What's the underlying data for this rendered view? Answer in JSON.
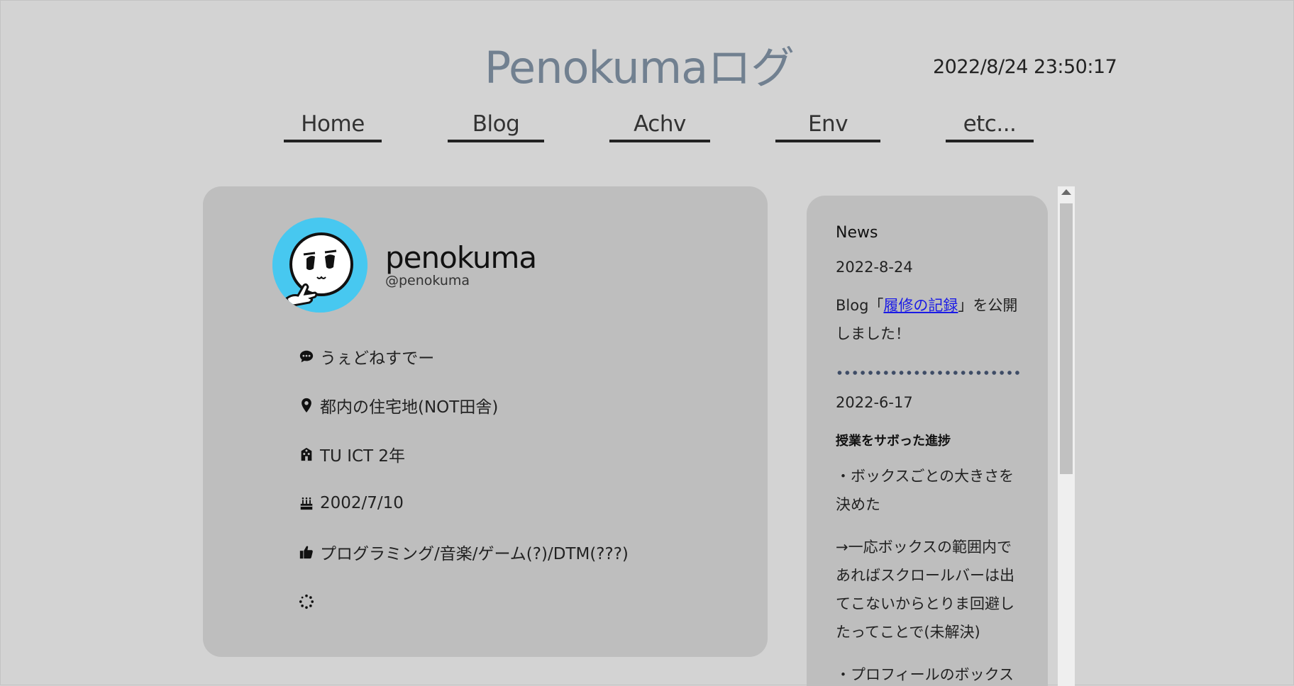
{
  "site": {
    "title": "Penokumaログ",
    "clock": "2022/8/24 23:50:17"
  },
  "nav": [
    {
      "label": "Home"
    },
    {
      "label": "Blog"
    },
    {
      "label": "Achv"
    },
    {
      "label": "Env"
    },
    {
      "label": "etc..."
    }
  ],
  "profile": {
    "name": "penokuma",
    "handle": "@penokuma",
    "avatar_icon": "penokuma-avatar",
    "avatar_bg": "#47c8f0",
    "status": {
      "icon": "comment-dots-icon",
      "text": "うぇどねすでー"
    },
    "location": {
      "icon": "map-pin-icon",
      "text": "都内の住宅地(NOT田舎)"
    },
    "school": {
      "icon": "school-icon",
      "text": "TU ICT 2年"
    },
    "birthday": {
      "icon": "birthday-cake-icon",
      "text": "2002/7/10"
    },
    "likes": {
      "icon": "thumbs-up-icon",
      "text": "プログラミング/音楽/ゲーム(?)/DTM(???)"
    },
    "loading_icon": "spinner-icon"
  },
  "news": {
    "heading": "News",
    "entries": [
      {
        "date": "2022-8-24",
        "prefix": "Blog「",
        "link_text": "履修の記録",
        "suffix": "」を公開",
        "line2": "しました！"
      },
      {
        "date": "2022-6-17",
        "title": "授業をサボった進捗",
        "lines": [
          "・ボックスごとの大きさを",
          "決めた",
          "→一応ボックスの範囲内で",
          "あればスクロールバーは出",
          "てこないからとりま回避し",
          "たってことで(未解決)",
          "・プロフィールのボックス"
        ]
      }
    ]
  },
  "colors": {
    "page_bg": "#d3d3d3",
    "card_bg": "#bebebe",
    "title_color": "#718090",
    "link_color": "#1a1ae6",
    "divider_dots": "#3e4c66"
  }
}
